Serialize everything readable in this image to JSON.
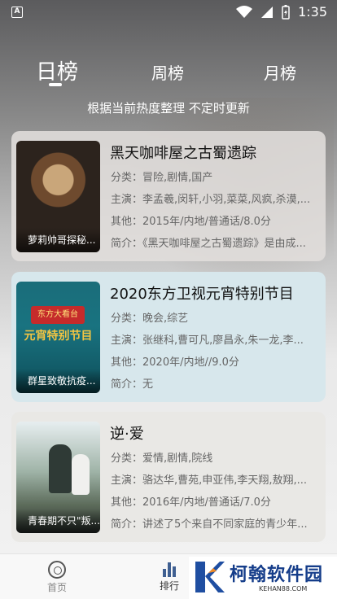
{
  "status_bar": {
    "app_icon_letter": "A",
    "time": "1:35"
  },
  "tabs": [
    {
      "label": "日榜",
      "active": true
    },
    {
      "label": "周榜",
      "active": false
    },
    {
      "label": "月榜",
      "active": false
    }
  ],
  "subtitle": "根据当前热度整理 不定时更新",
  "items": [
    {
      "title": "黑天咖啡屋之古蜀遗踪",
      "poster_text": "萝莉帅哥探秘...",
      "category": "分类：冒险,剧情,国产",
      "cast": "主演：李孟羲,闵轩,小羽,菜菜,风疯,杀漠,...",
      "other": "其他：2015年/内地/普通话/8.0分",
      "intro": "简介：《黑天咖啡屋之古蜀遗踪》是由成..."
    },
    {
      "title": "2020东方卫视元宵特别节目",
      "poster_text": "群星致敬抗疫...",
      "poster_banner": "元宵特别节目",
      "poster_top": "东方大看台",
      "category": "分类：晚会,综艺",
      "cast": "主演：张继科,曹可凡,廖昌永,朱一龙,李...",
      "other": "其他：2020年/内地//9.0分",
      "intro": "简介：无"
    },
    {
      "title": "逆·爱",
      "poster_text": "青春期不只\"叛...",
      "category": "分类：爱情,剧情,院线",
      "cast": "主演：骆达华,曹苑,申亚伟,李天翔,敖翔,...",
      "other": "其他：2016年/内地/普通话/7.0分",
      "intro": "简介：讲述了5个来自不同家庭的青少年..."
    }
  ],
  "bottom_nav": {
    "home_label": "首页",
    "rank_label": "排行"
  },
  "watermark": {
    "title": "柯翰软件园",
    "sub": "KEHAN88.COM"
  }
}
